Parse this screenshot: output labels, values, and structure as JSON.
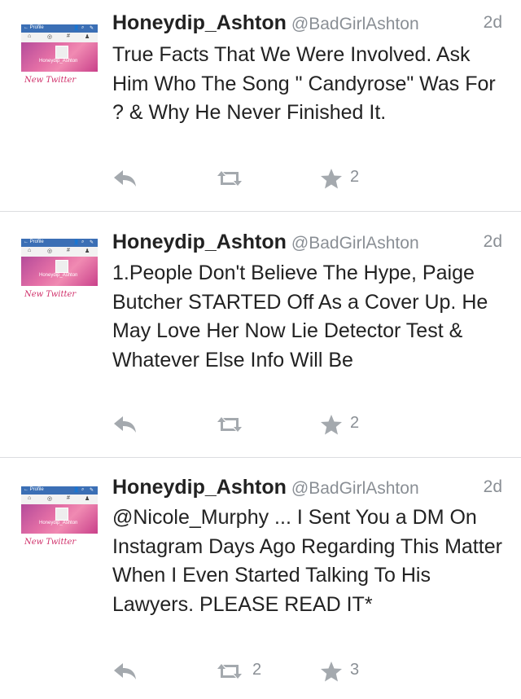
{
  "tweets": [
    {
      "name": "Honeydip_Ashton",
      "handle": "@BadGirlAshton",
      "time": "2d",
      "avatar_tag": "New Twitter",
      "avatar_name": "Honeydip_Ashton",
      "text": "True Facts That We Were Involved. Ask Him Who The Song \" Candyrose\" Was For ? & Why He Never Finished It.",
      "retweets": "",
      "favorites": "2"
    },
    {
      "name": "Honeydip_Ashton",
      "handle": "@BadGirlAshton",
      "time": "2d",
      "avatar_tag": "New Twitter",
      "avatar_name": "Honeydip_Ashton",
      "text": "1.People Don't Believe The Hype, Paige Butcher STARTED Off As a Cover Up. He May Love Her Now Lie Detector Test & Whatever Else Info Will Be",
      "retweets": "",
      "favorites": "2"
    },
    {
      "name": "Honeydip_Ashton",
      "handle": "@BadGirlAshton",
      "time": "2d",
      "avatar_tag": "New Twitter",
      "avatar_name": "Honeydip_Ashton",
      "text": "@Nicole_Murphy ... I Sent You a DM On Instagram Days Ago Regarding This Matter When I Even Started Talking To His Lawyers. PLEASE READ IT*",
      "retweets": "2",
      "favorites": "3"
    }
  ],
  "icons": {
    "reply": "reply-icon",
    "retweet": "retweet-icon",
    "favorite": "star-icon"
  },
  "colors": {
    "text": "#222222",
    "muted": "#8a8f95",
    "icon": "#9aa0a6",
    "divider": "#dcdde0"
  }
}
